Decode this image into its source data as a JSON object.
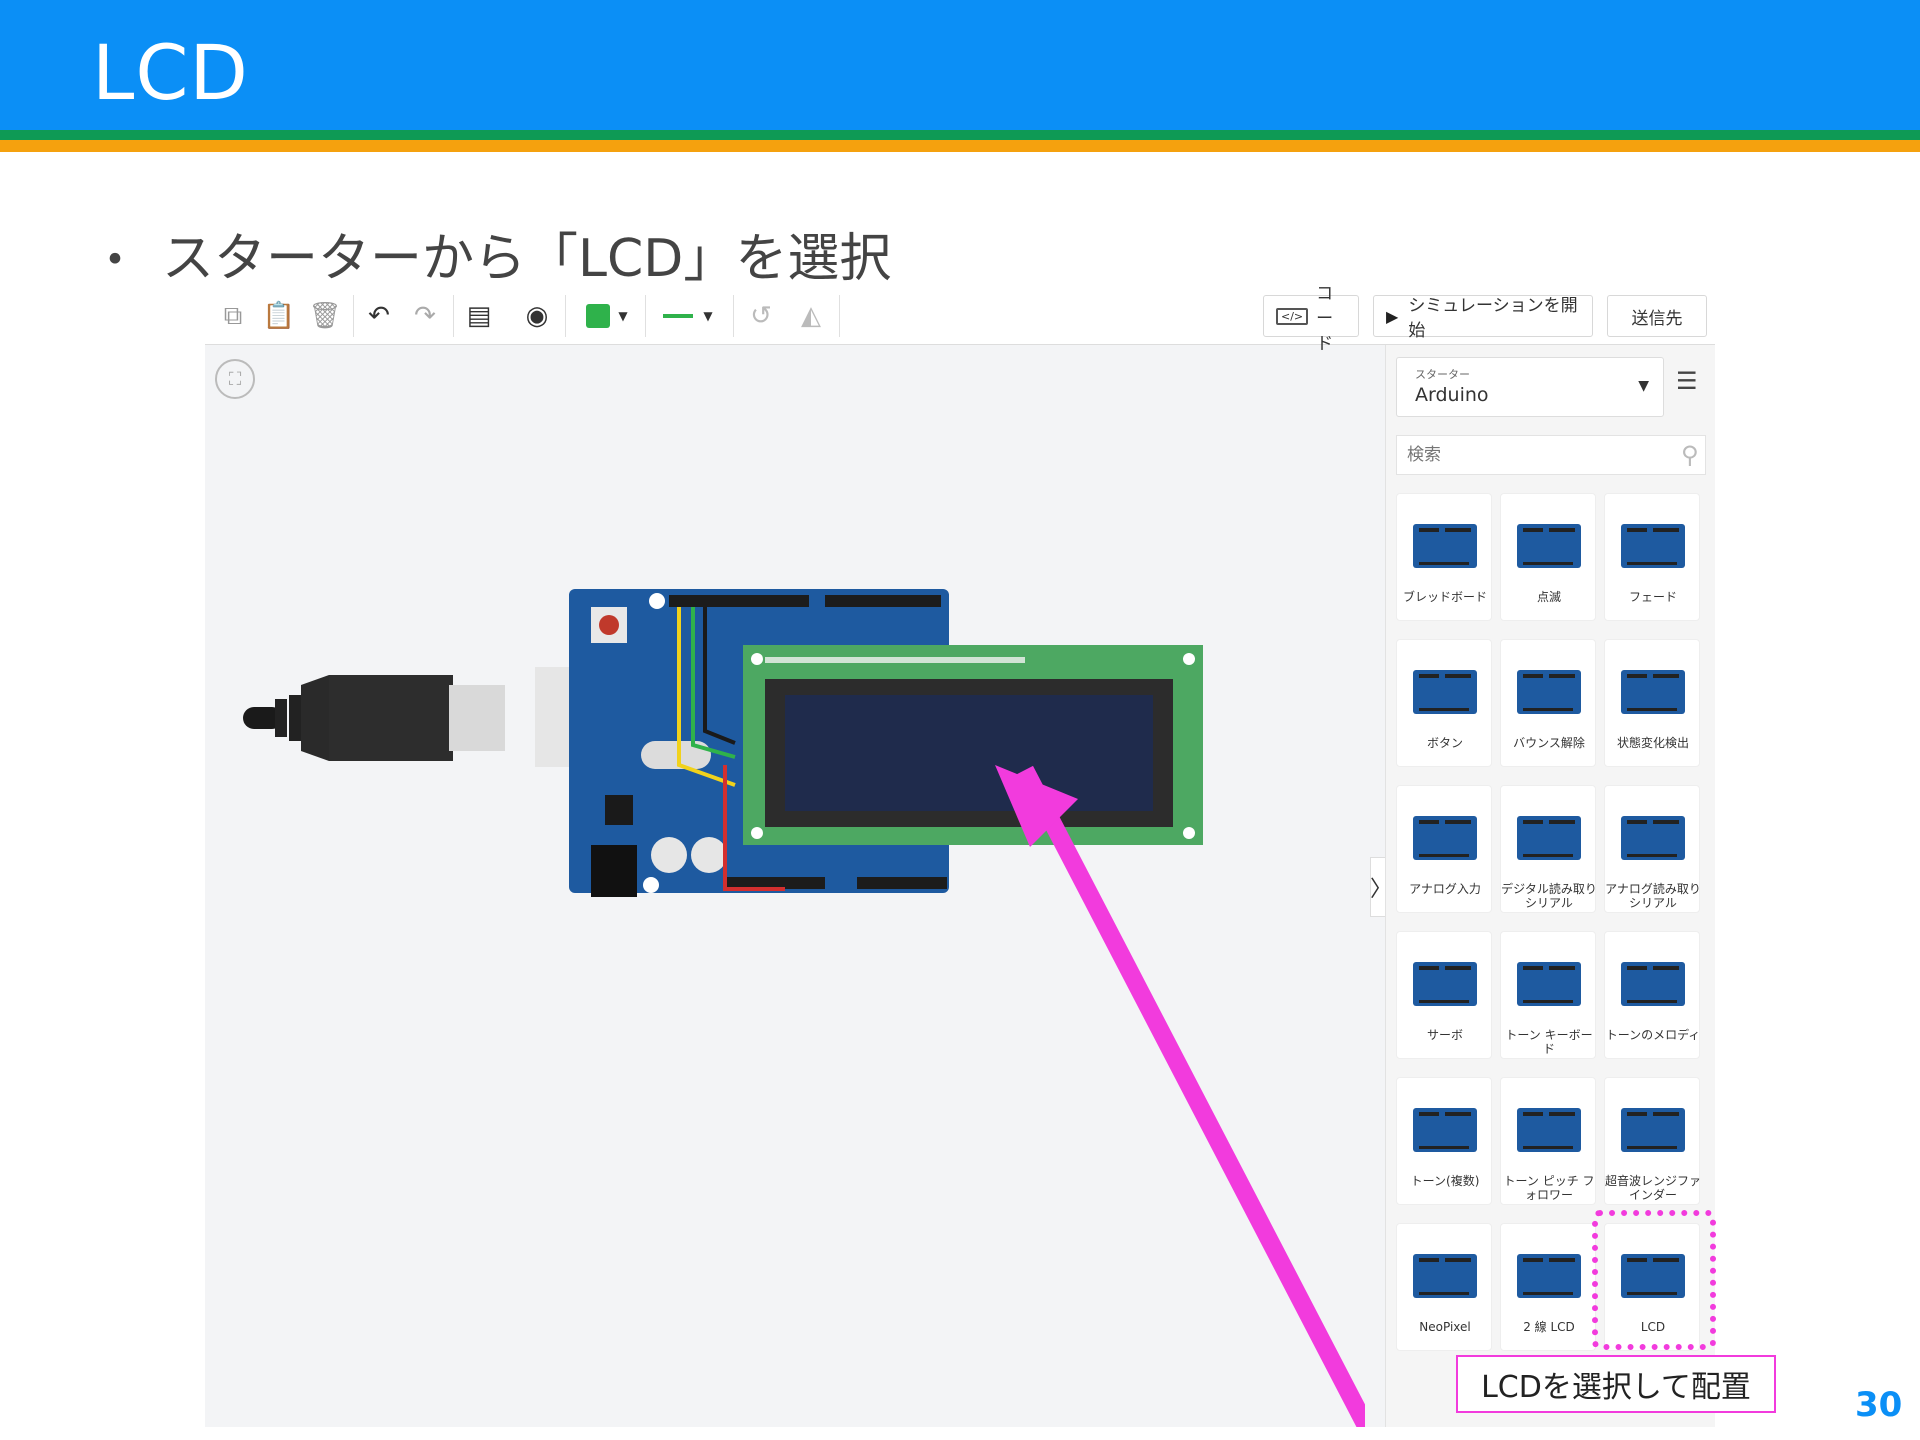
{
  "slide": {
    "title": "LCD",
    "bullet_symbol": "・",
    "bullet_text": "スターターから「LCD」を選択",
    "callout": "LCDを選択して配置",
    "page_number": "30"
  },
  "toolbar": {
    "code_label": "コード",
    "simulate_label": "シミュレーションを開始",
    "send_label": "送信先",
    "color_swatch": "#2fb24b",
    "line_color": "#2fb24b"
  },
  "panel": {
    "starter_label": "スターター",
    "starter_value": "Arduino",
    "search_placeholder": "検索",
    "cards": [
      {
        "label": "ブレッドボード"
      },
      {
        "label": "点滅"
      },
      {
        "label": "フェード"
      },
      {
        "label": "ボタン"
      },
      {
        "label": "バウンス解除"
      },
      {
        "label": "状態変化検出"
      },
      {
        "label": "アナログ入力"
      },
      {
        "label": "デジタル読み取りシリアル"
      },
      {
        "label": "アナログ読み取りシリアル"
      },
      {
        "label": "サーボ"
      },
      {
        "label": "トーン キーボード"
      },
      {
        "label": "トーンのメロディ"
      },
      {
        "label": "トーン(複数)"
      },
      {
        "label": "トーン ピッチ フォロワー"
      },
      {
        "label": "超音波レンジファインダー"
      },
      {
        "label": "NeoPixel"
      },
      {
        "label": "2 線 LCD"
      },
      {
        "label": "LCD"
      }
    ]
  },
  "colors": {
    "header": "#0b8ff6",
    "arrow": "#f23bdd",
    "arduino_board": "#1e5aa0",
    "lcd_board": "#4da862",
    "lcd_screen": "#1f2b4c"
  }
}
